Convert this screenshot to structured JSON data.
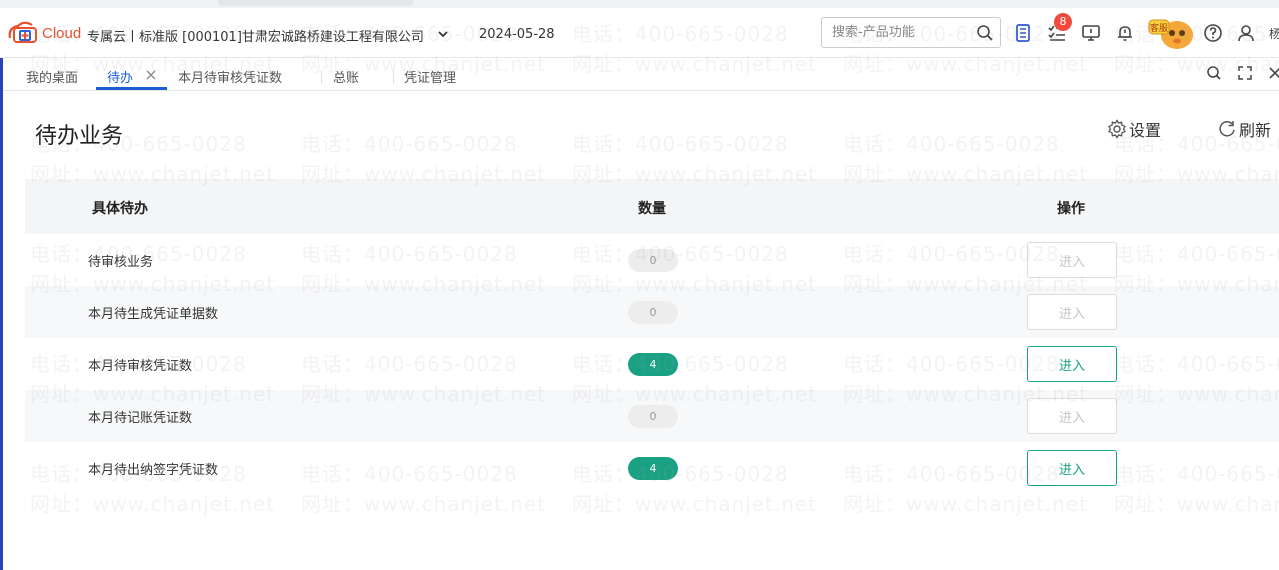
{
  "header": {
    "logo_text": "Cloud",
    "product": "专属云丨标准版 [000101]甘肃宏诚路桥建设工程有限公司",
    "date": "2024-05-28",
    "search_placeholder": "搜索-产品功能",
    "notification_badge": "8",
    "mascot_label": "客服",
    "user_initial": "杨"
  },
  "tabs": [
    {
      "label": "我的桌面"
    },
    {
      "label": "待办"
    },
    {
      "label": "本月待审核凭证数"
    },
    {
      "label": "总账"
    },
    {
      "label": "凭证管理"
    }
  ],
  "page": {
    "title": "待办业务",
    "settings_label": "设置",
    "refresh_label": "刷新"
  },
  "table": {
    "headers": [
      "具体待办",
      "数量",
      "操作"
    ],
    "rows": [
      {
        "name": "待审核业务",
        "count": "0",
        "action": "进入",
        "enabled": false
      },
      {
        "name": "本月待生成凭证单据数",
        "count": "0",
        "action": "进入",
        "enabled": false
      },
      {
        "name": "本月待审核凭证数",
        "count": "4",
        "action": "进入",
        "enabled": true
      },
      {
        "name": "本月待记账凭证数",
        "count": "0",
        "action": "进入",
        "enabled": false
      },
      {
        "name": "本月待出纳签字凭证数",
        "count": "4",
        "action": "进入",
        "enabled": true
      }
    ]
  },
  "watermark": {
    "phone": "电话：400-665-0028",
    "site": "网址：www.chanjet.net"
  },
  "colors": {
    "primary_blue": "#1b5ed2",
    "accent_green": "#1aa184",
    "badge_red": "#f04b3c",
    "brand_orange": "#e8502f"
  }
}
